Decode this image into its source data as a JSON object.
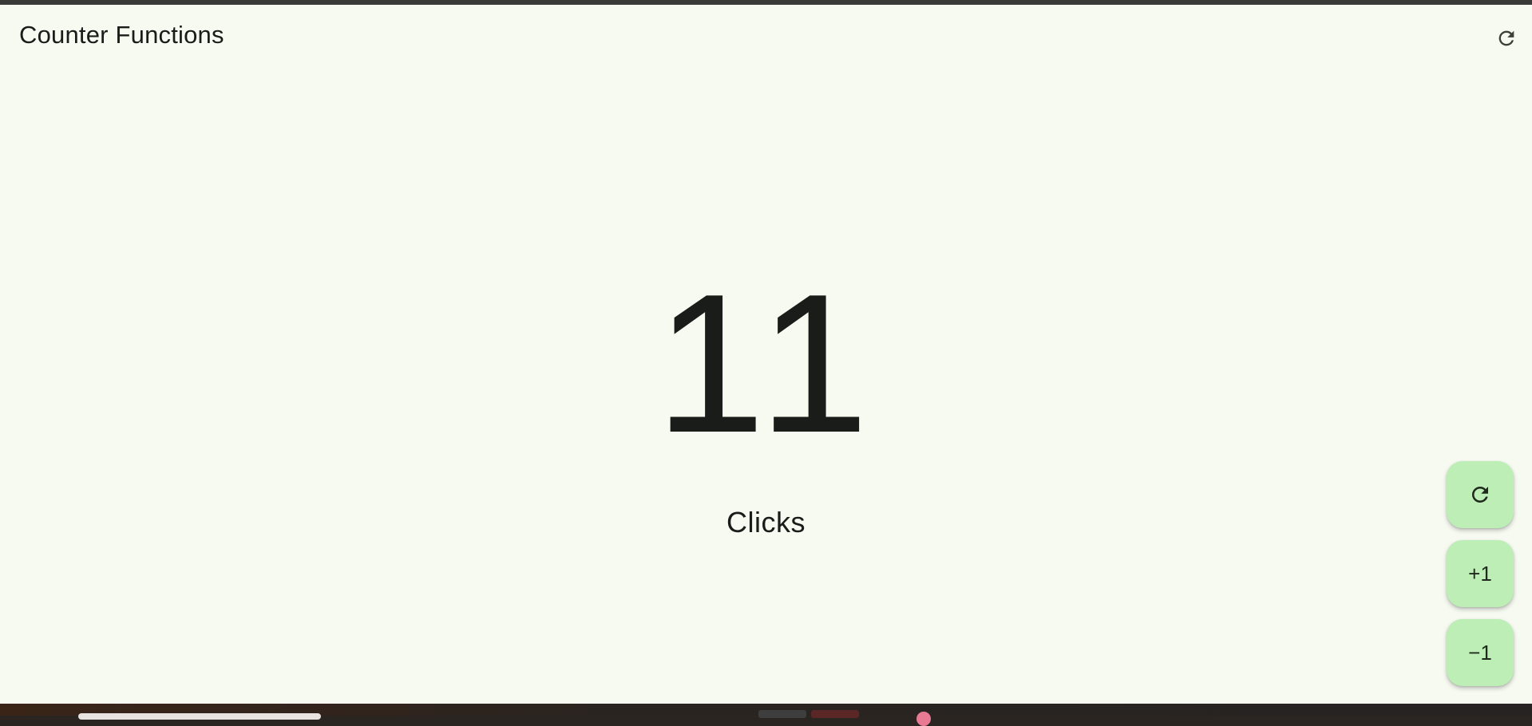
{
  "app": {
    "title": "Counter Functions"
  },
  "counter": {
    "value": "11",
    "label": "Clicks"
  },
  "fabs": {
    "reset_icon": "refresh-icon",
    "increment_label": "+1",
    "decrement_label": "−1"
  },
  "colors": {
    "background": "#f6faf1",
    "fab": "#bdeeb5",
    "text": "#191c18"
  }
}
